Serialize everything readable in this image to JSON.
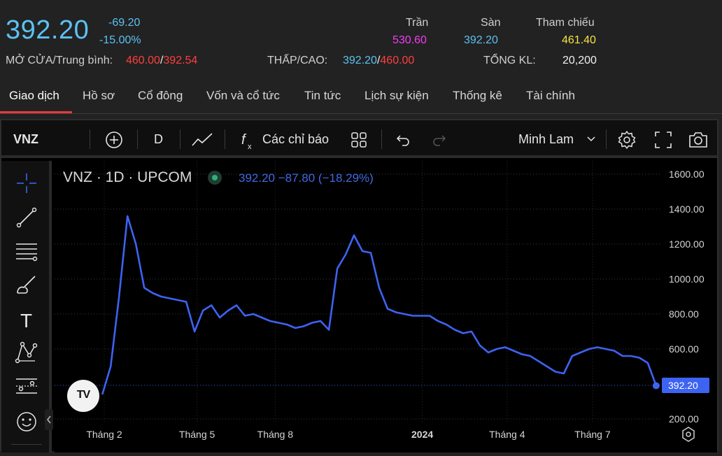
{
  "quote": {
    "price": "392.20",
    "change": "-69.20",
    "change_pct": "-15.00%",
    "open_avg_label": "MỞ CỬA/Trung bình:",
    "open": "460.00",
    "avg": "392.54",
    "lowhigh_label": "THẤP/CAO:",
    "low": "392.20",
    "high": "460.00",
    "ceiling_label": "Trần",
    "ceiling": "530.60",
    "floor_label": "Sàn",
    "floor": "392.20",
    "ref_label": "Tham chiếu",
    "ref": "461.40",
    "volume_label": "TỔNG KL:",
    "volume": "20,200",
    "slash": "/"
  },
  "tabs": [
    {
      "label": "Giao dịch"
    },
    {
      "label": "Hồ sơ"
    },
    {
      "label": "Cổ đông"
    },
    {
      "label": "Vốn và cổ tức"
    },
    {
      "label": "Tin tức"
    },
    {
      "label": "Lịch sự kiện"
    },
    {
      "label": "Thống kê"
    },
    {
      "label": "Tài chính"
    }
  ],
  "toolbar": {
    "symbol": "VNZ",
    "interval": "D",
    "indicators_label": "Các chỉ báo",
    "theme_label": "Minh Lam"
  },
  "legend": {
    "title": "VNZ · 1D · UPCOM",
    "stats": "392.20  −87.80 (−18.29%)",
    "logo_text": "TV"
  },
  "colors": {
    "line": "#3d63f2",
    "up_cyan": "#5bc2f3",
    "down_red": "#ff3e3e",
    "ceiling_magenta": "#f23cf2",
    "ref_yellow": "#f4e443",
    "price_tag_bg": "#3d63f2"
  },
  "chart_data": {
    "type": "line",
    "x_ticks": [
      "Tháng 2",
      "Tháng 5",
      "Tháng 8",
      "2024",
      "Tháng 4",
      "Tháng 7"
    ],
    "y_ticks": [
      "1600.00",
      "1400.00",
      "1200.00",
      "1000.00",
      "800.00",
      "600.00",
      "200.00"
    ],
    "ylim": [
      120,
      1620
    ],
    "last_price_label": "392.20",
    "last_price": 392.2,
    "grid": true,
    "series": [
      {
        "values": [
          340,
          500,
          900,
          1360,
          1200,
          950,
          920,
          900,
          890,
          880,
          870,
          700,
          820,
          850,
          780,
          820,
          850,
          790,
          800,
          780,
          760,
          750,
          740,
          720,
          730,
          750,
          760,
          710,
          1060,
          1140,
          1250,
          1160,
          1150,
          950,
          830,
          810,
          800,
          790,
          790,
          790,
          760,
          740,
          710,
          690,
          700,
          620,
          580,
          600,
          610,
          590,
          570,
          560,
          530,
          500,
          470,
          460,
          560,
          580,
          600,
          610,
          600,
          590,
          560,
          560,
          550,
          520,
          390
        ]
      }
    ]
  }
}
